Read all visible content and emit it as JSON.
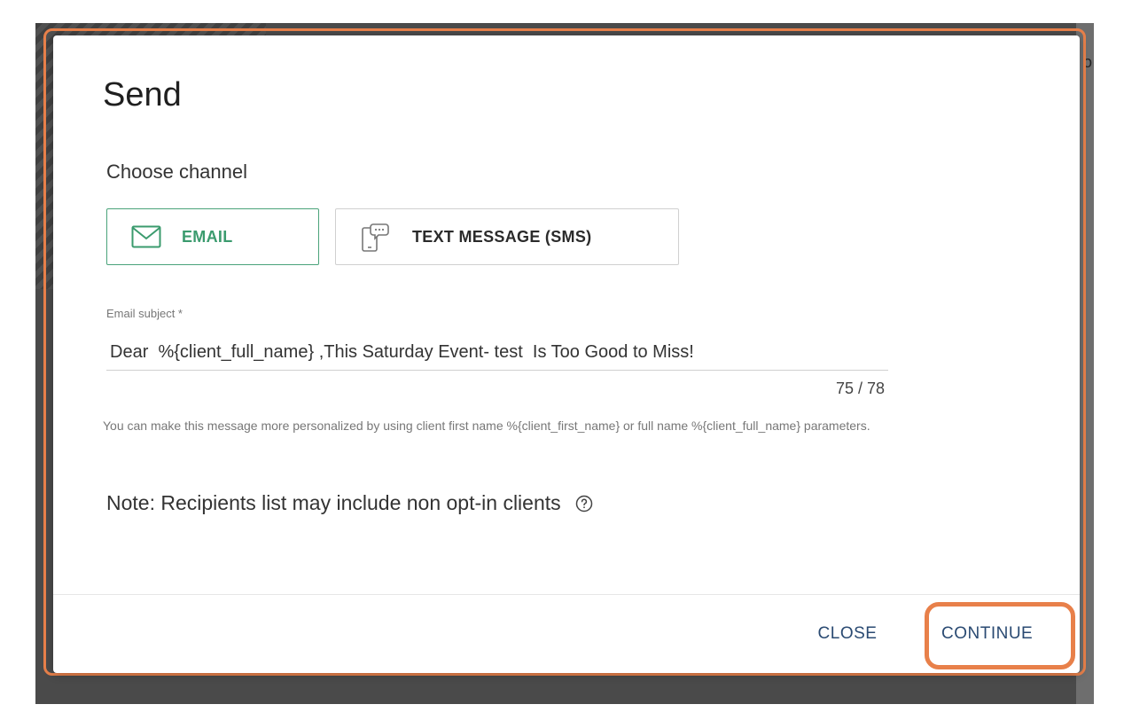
{
  "background": {
    "right_edge_glyph": "o"
  },
  "dialog": {
    "title": "Send",
    "choose_channel_label": "Choose channel",
    "channels": [
      {
        "label": "EMAIL",
        "icon": "envelope-icon",
        "selected": true
      },
      {
        "label": "TEXT MESSAGE (SMS)",
        "icon": "phone-chat-icon",
        "selected": false
      }
    ],
    "subject": {
      "label": "Email subject *",
      "value": "Dear  %{client_full_name} ,This Saturday Event- test  Is Too Good to Miss!",
      "counter": "75 / 78"
    },
    "hint": "You can make this message more personalized by using client first name %{client_first_name} or full name %{client_full_name} parameters.",
    "note": "Note: Recipients list may include non opt-in clients",
    "buttons": {
      "close": "CLOSE",
      "continue": "CONTINUE"
    }
  },
  "colors": {
    "accent_green": "#3b9b6e",
    "button_text": "#2a4a72",
    "highlight_orange": "#e8804a"
  }
}
